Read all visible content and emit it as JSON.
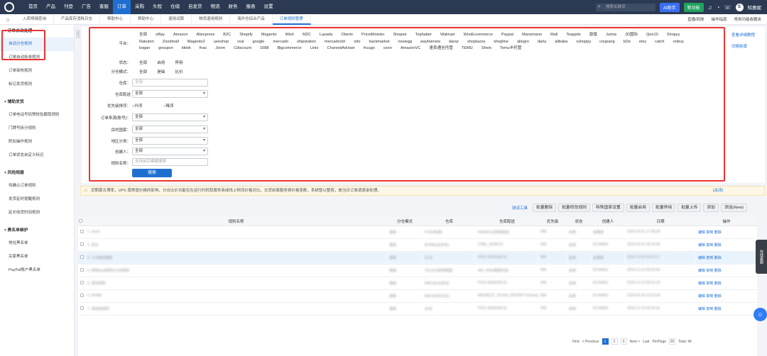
{
  "topnav": {
    "items": [
      "首页",
      "产品",
      "刊登",
      "广告",
      "客服",
      "订单",
      "采购",
      "头程",
      "仓储",
      "自发货",
      "物流",
      "财务",
      "报表",
      "设置"
    ],
    "active_index": 5,
    "search_placeholder": "搜索关键词",
    "ai_label": "AI助手",
    "new_label": "新功能",
    "avatar_letter": "S",
    "username": "知惠妮"
  },
  "tabs": {
    "items": [
      "入库明细查询",
      "产品库存消耗日志",
      "帮助中心",
      "帮助中心",
      "退用试算",
      "物流退用规则",
      "海外仓综合产品",
      "订单规则管理"
    ],
    "active_index": 7,
    "right": [
      "直播/回放",
      "操作指南",
      "常用功能收藏夹"
    ]
  },
  "sidebar": {
    "groups": [
      {
        "title": "订单自动处理",
        "items": [
          "自动分仓规则",
          "订单自动拆单规则",
          "订单审核规则",
          "标记发货规则"
        ]
      },
      {
        "title": "辅助发货",
        "items": [
          "订单电话号码预校验截取规则",
          "门牌号拆分规则",
          "附加操作规则",
          "订单状态自定义标记"
        ]
      },
      {
        "title": "风险规避",
        "items": [
          "待确认订单规则",
          "发货延时提醒规则",
          "延长收货时间规则"
        ]
      },
      {
        "title": "黑名单维护",
        "items": [
          "地址黑名单",
          "买家黑名单",
          "PayPal账户黑名单"
        ]
      }
    ],
    "active": "自动分仓规则"
  },
  "filters": {
    "platform_label": "平台：",
    "platforms": [
      "全部",
      "eBay",
      "Amazon",
      "Aliexpress",
      "B2C",
      "Shopify",
      "Magento",
      "Wish",
      "M2C",
      "Lazada",
      "Oberlo",
      "PriceMinister",
      "Shopee",
      "Tophatter",
      "Walmart",
      "WooEcommerce",
      "Paypal",
      "Manomano",
      "Mall",
      "Teapplix",
      "敦煌",
      "Jumia",
      "JD国际",
      "Qoo10",
      "Shopyy",
      "Rakuten",
      "Zoodmall",
      "Magento2",
      "ueeshop",
      "real",
      "google",
      "mercado",
      "shipstation",
      "mercadocbt",
      "otto",
      "backmarket",
      "newegg",
      "wayfairnew",
      "daraz",
      "shoplazza",
      "shopline",
      "allegro",
      "darty",
      "alibaba",
      "xshoppy",
      "coupang",
      "b2w",
      "etsy",
      "catch",
      "onbuy",
      "kogan",
      "groupon",
      "tiktok",
      "fnac",
      "Joom",
      "Cdiscount",
      "1688",
      "Bigcommerce",
      "Linio",
      "ChannelAdviser",
      "fruugo",
      "ozon",
      "AmazonVC",
      "速卖通全托管",
      "TEMU",
      "Shein",
      "Temu半托管"
    ],
    "status_label": "状态：",
    "status_options": [
      "全部",
      "启用",
      "停用"
    ],
    "mode_label": "分仓模式：",
    "mode_options": [
      "全部",
      "是础",
      "比价"
    ],
    "warehouse_label": "仓库：",
    "warehouse_placeholder": "全部",
    "wh_config_label": "仓库配送",
    "wh_config_value": "全部",
    "priority_label": "优先级排序：",
    "priority_options": [
      "升序",
      "降序"
    ],
    "source_label": "订单来源(账号)：",
    "source_value": "全部",
    "country_label": "目的国家：",
    "country_value": "全部",
    "region_label": "地区分类：",
    "region_value": "全部",
    "creator_label": "创建人：",
    "creator_value": "全部",
    "rule_name_label": "规则名称：",
    "rule_name_placeholder": "支持前后模糊搜索",
    "search_button": "搜索",
    "right_links": [
      "查看详细教程",
      "切换新版"
    ]
  },
  "notice": {
    "text": "近期黄五博率，UPS 尊崇退价格的影响，分合比价功能仅在运行时机取服务商或线上物流价格对比，交货前面服务费价格涨跌，系统暂以整按，故当日订单调退审处理。",
    "close": "[关闭]"
  },
  "toolbar": {
    "link": "测试工具",
    "buttons": [
      "批量删除",
      "批量修改规则",
      "特殊国家设置",
      "批量启用",
      "批量停用",
      "批量上传",
      "添加",
      "添加(New)"
    ]
  },
  "table": {
    "headers": [
      "",
      "规则名称",
      "分仓模式",
      "仓库",
      "仓库配送",
      "优先级",
      "状态",
      "创建人",
      "日期",
      "操作"
    ],
    "rows": [
      [
        "1. moon",
        "基础",
        "FG仓库(美)",
        "FRANCE(高效配送)",
        "999",
        "启用",
        "如惠妮",
        "2024-05-21 17:46:59",
        "编辑 复制 删除"
      ],
      [
        "2. 空白",
        "基础",
        "BYNBJ(北京仓)",
        "CNEL_BJ(NC2)",
        "999",
        "启用",
        "ECHANG",
        "2024-05-01 09:15:06",
        "编辑 复制 删除"
      ],
      [
        "3. 小鸟物流推荐",
        "基础",
        "A1仓",
        "PICK-SEND(NC4)",
        "999",
        "启用",
        "如惠妮",
        "2024-12-03 09:03:17",
        "编辑 复制 删除"
      ],
      [
        "4. 规则(bu退费的分合规则)",
        "基础",
        "YQ-DG(常规美国)",
        "APL.#PA(美国专线)",
        "999",
        "启用",
        "ECHANG",
        "2024-12-13 09:33:45",
        "编辑 复制 删除"
      ],
      [
        "5. 测试规则",
        "基础",
        "BAICAI(北京仓)",
        "PICK-SEND(NC4)",
        "999",
        "启用",
        "ECHANG",
        "2024-12-13 09:41:20",
        "编辑 复制 删除"
      ],
      [
        "6. HOME",
        "基础",
        "BAICAI(乐天仓)",
        "MIDWEST_TEXAS_PRIORITY(Suma)",
        "999",
        "启用",
        "ECHANG",
        "2024-06-18 10:22:59",
        "编辑 复制 删除"
      ],
      [
        "7. 测试前规则",
        "基础",
        "A2仓",
        "PICK-SEND(NC4)",
        "999",
        "启用",
        "ECHANG",
        "2024-12-10 09:33:41",
        "编辑 复制 删除"
      ]
    ],
    "highlight_row": 2
  },
  "pager": {
    "first": "First",
    "prev": "< Previous",
    "pages": [
      "1",
      "2",
      "3"
    ],
    "active": "1",
    "next": "Next >",
    "last": "Last",
    "perpage": "PerPage",
    "perpage_value": "20",
    "total": "Total: 46"
  },
  "float_label": "在线客服",
  "colors": {
    "nav": "#2b3a52",
    "accent": "#1f6fd1",
    "highlight_border": "#ee3333"
  }
}
